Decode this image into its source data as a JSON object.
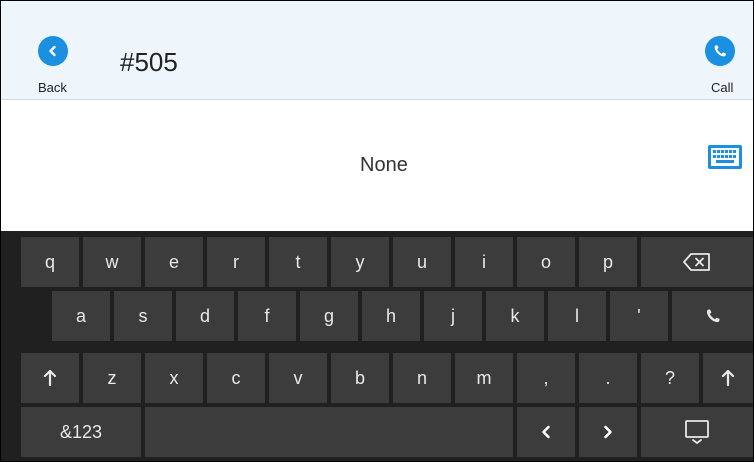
{
  "header": {
    "back_label": "Back",
    "title": "#505",
    "call_label": "Call"
  },
  "content": {
    "status_text": "None"
  },
  "accent_color": "#1b8fe0",
  "icons": {
    "back": "back-chevron-icon",
    "call": "phone-icon",
    "keyboard_toggle": "keyboard-icon",
    "backspace": "backspace-icon",
    "shift": "shift-arrow-icon",
    "hide_keyboard": "hide-keyboard-icon",
    "cursor_left": "chevron-left-icon",
    "cursor_right": "chevron-right-icon"
  },
  "keyboard": {
    "row1": [
      "q",
      "w",
      "e",
      "r",
      "t",
      "y",
      "u",
      "i",
      "o",
      "p"
    ],
    "row2": [
      "a",
      "s",
      "d",
      "f",
      "g",
      "h",
      "j",
      "k",
      "l",
      "'"
    ],
    "row3": [
      "z",
      "x",
      "c",
      "v",
      "b",
      "n",
      "m",
      ",",
      ".",
      "?"
    ],
    "symbols_label": "&123"
  }
}
